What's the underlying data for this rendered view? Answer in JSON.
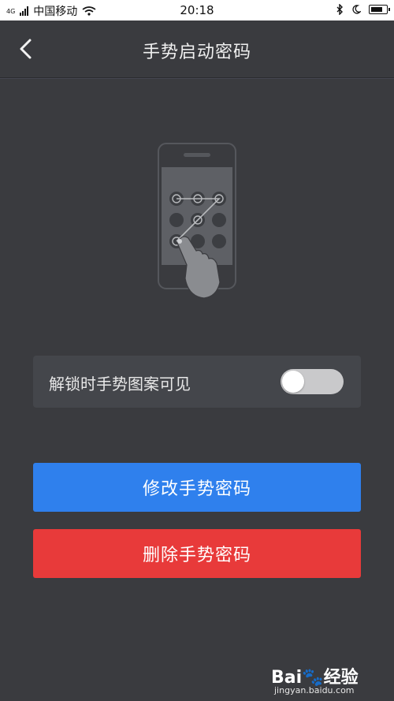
{
  "status_bar": {
    "carrier": "中国移动",
    "network_badge": "4G",
    "time": "20:18",
    "icons": [
      "signal-icon",
      "wifi-icon",
      "bluetooth-icon",
      "moon-icon",
      "battery-icon"
    ]
  },
  "header": {
    "title": "手势启动密码",
    "back_icon": "chevron-left-icon"
  },
  "illustration": {
    "description_icon": "gesture-unlock-illustration"
  },
  "option": {
    "label": "解锁时手势图案可见",
    "toggle_on": false
  },
  "buttons": {
    "modify": "修改手势密码",
    "delete": "删除手势密码"
  },
  "watermark": {
    "brand": "Bai",
    "brand_suffix": "经验",
    "url": "jingyan.baidu.com"
  },
  "colors": {
    "background": "#3a3b3f",
    "blue_button": "#2f80ed",
    "red_button": "#e83a3a",
    "row_background": "#44464b"
  }
}
